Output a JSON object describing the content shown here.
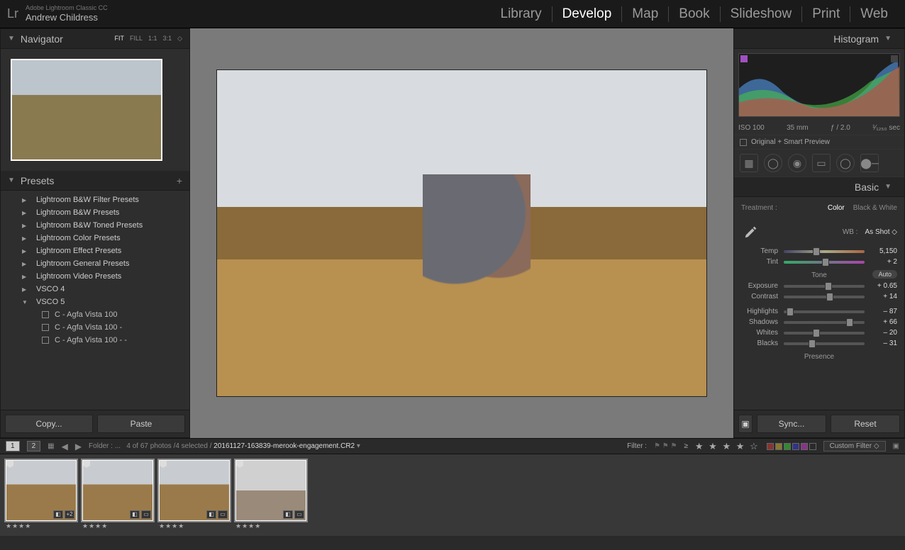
{
  "app": {
    "name": "Adobe Lightroom Classic CC",
    "user": "Andrew Childress",
    "logo": "Lr"
  },
  "modules": [
    "Library",
    "Develop",
    "Map",
    "Book",
    "Slideshow",
    "Print",
    "Web"
  ],
  "active_module": "Develop",
  "navigator": {
    "title": "Navigator",
    "zoom_options": [
      "FIT",
      "FILL",
      "1:1",
      "3:1"
    ],
    "zoom_active": "FIT"
  },
  "presets": {
    "title": "Presets",
    "folders": [
      "Lightroom B&W Filter Presets",
      "Lightroom B&W Presets",
      "Lightroom B&W Toned Presets",
      "Lightroom Color Presets",
      "Lightroom Effect Presets",
      "Lightroom General Presets",
      "Lightroom Video Presets",
      "VSCO 4",
      "VSCO 5"
    ],
    "expanded_index": 8,
    "sub_items": [
      "C - Agfa Vista 100",
      "C - Agfa Vista 100 -",
      "C - Agfa Vista 100 - -"
    ]
  },
  "left_buttons": {
    "copy": "Copy...",
    "paste": "Paste"
  },
  "histogram": {
    "title": "Histogram",
    "iso": "ISO 100",
    "focal": "35 mm",
    "aperture": "ƒ / 2.0",
    "shutter": "¹⁄₁₂₅₀ sec",
    "preview": "Original + Smart Preview"
  },
  "basic": {
    "title": "Basic",
    "treatment_label": "Treatment :",
    "treatment_options": [
      "Color",
      "Black & White"
    ],
    "treatment_active": "Color",
    "wb_label": "WB :",
    "wb_value": "As Shot",
    "temp": {
      "label": "Temp",
      "value": "5,150",
      "pos": 40
    },
    "tint": {
      "label": "Tint",
      "value": "+ 2",
      "pos": 52
    },
    "tone_label": "Tone",
    "auto_label": "Auto",
    "exposure": {
      "label": "Exposure",
      "value": "+ 0.65",
      "pos": 55
    },
    "contrast": {
      "label": "Contrast",
      "value": "+ 14",
      "pos": 57
    },
    "highlights": {
      "label": "Highlights",
      "value": "– 87",
      "pos": 8
    },
    "shadows": {
      "label": "Shadows",
      "value": "+ 66",
      "pos": 82
    },
    "whites": {
      "label": "Whites",
      "value": "– 20",
      "pos": 40
    },
    "blacks": {
      "label": "Blacks",
      "value": "– 31",
      "pos": 35
    },
    "presence_label": "Presence"
  },
  "right_buttons": {
    "sync": "Sync...",
    "reset": "Reset"
  },
  "filmstrip_bar": {
    "views": [
      "1",
      "2"
    ],
    "folder_label": "Folder : ...",
    "count": "4 of 67 photos /4 selected /",
    "filename": "20161127-163839-merook-engagement.CR2",
    "filter_label": "Filter :",
    "rating_op": "≥",
    "custom_filter": "Custom Filter"
  },
  "filmstrip": {
    "thumbs": [
      {
        "stars": "★★★★",
        "selected": true,
        "badge": "+2"
      },
      {
        "stars": "★★★★",
        "selected": true,
        "badge": ""
      },
      {
        "stars": "★★★★",
        "selected": true,
        "badge": ""
      },
      {
        "stars": "★★★★",
        "selected": true,
        "badge": ""
      }
    ]
  }
}
